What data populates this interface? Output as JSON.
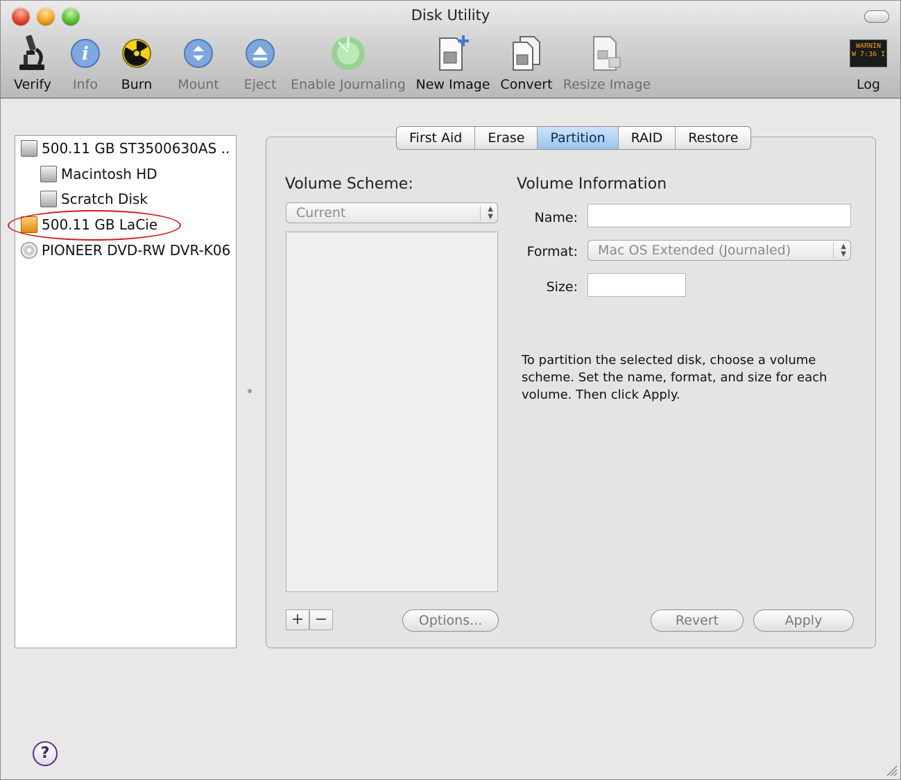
{
  "window": {
    "title": "Disk Utility"
  },
  "toolbar": {
    "items": [
      {
        "label": "Verify",
        "icon": "microscope-icon",
        "enabled": true
      },
      {
        "label": "Info",
        "icon": "info-icon",
        "enabled": false
      },
      {
        "label": "Burn",
        "icon": "burn-icon",
        "enabled": true
      },
      {
        "label": "Mount",
        "icon": "mount-icon",
        "enabled": false
      },
      {
        "label": "Eject",
        "icon": "eject-icon",
        "enabled": false
      },
      {
        "label": "Enable Journaling",
        "icon": "journaling-icon",
        "enabled": false
      },
      {
        "label": "New Image",
        "icon": "new-image-icon",
        "enabled": true
      },
      {
        "label": "Convert",
        "icon": "convert-icon",
        "enabled": true
      },
      {
        "label": "Resize Image",
        "icon": "resize-image-icon",
        "enabled": false
      },
      {
        "label": "Log",
        "icon": "log-icon",
        "enabled": true
      }
    ],
    "log_icon_text": [
      "WARNIN",
      "W 7:36 I"
    ]
  },
  "sidebar": {
    "items": [
      {
        "label": "500.11 GB ST3500630AS ..",
        "icon": "hard-disk-icon",
        "level": 0
      },
      {
        "label": "Macintosh HD",
        "icon": "volume-icon",
        "level": 1
      },
      {
        "label": "Scratch Disk",
        "icon": "volume-icon",
        "level": 1
      },
      {
        "label": "500.11 GB LaCie",
        "icon": "external-disk-icon",
        "level": 0,
        "highlighted": true
      },
      {
        "label": "PIONEER DVD-RW DVR-K06",
        "icon": "optical-drive-icon",
        "level": 0
      }
    ]
  },
  "tabs": [
    "First Aid",
    "Erase",
    "Partition",
    "RAID",
    "Restore"
  ],
  "active_tab": "Partition",
  "partition": {
    "scheme_title": "Volume Scheme:",
    "scheme_value": "Current",
    "info_title": "Volume Information",
    "name_label": "Name:",
    "name_value": "",
    "format_label": "Format:",
    "format_value": "Mac OS Extended (Journaled)",
    "size_label": "Size:",
    "size_value": "",
    "help_text": "To partition the selected disk, choose a volume scheme. Set the name, format, and size for each volume. Then click Apply.",
    "add_label": "+",
    "remove_label": "−",
    "options_label": "Options...",
    "revert_label": "Revert",
    "apply_label": "Apply"
  },
  "help_label": "?",
  "colors": {
    "accent": "#9cc4ee",
    "highlight_ring": "#d11a1a"
  }
}
